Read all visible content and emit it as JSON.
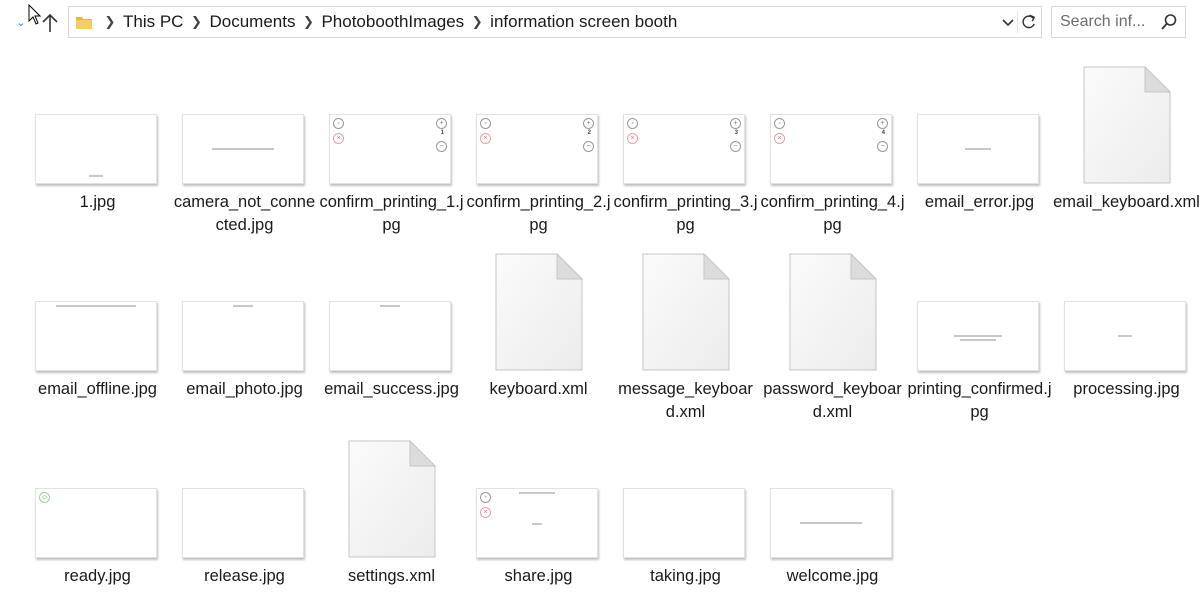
{
  "navbar": {
    "breadcrumb": [
      "This PC",
      "Documents",
      "PhotoboothImages",
      "information screen booth"
    ],
    "search_placeholder": "Search inf...",
    "icons": {
      "recent": "chevron-down-icon",
      "up": "up-arrow-icon",
      "folder": "folder-icon",
      "dropdown": "chevron-down-icon",
      "refresh": "refresh-icon",
      "search": "search-icon"
    }
  },
  "files": [
    {
      "name": "1.jpg",
      "type": "jpg"
    },
    {
      "name": "camera_not_connected.jpg",
      "type": "jpg"
    },
    {
      "name": "confirm_printing_1.jpg",
      "type": "jpg",
      "thumb_number": "1"
    },
    {
      "name": "confirm_printing_2.jpg",
      "type": "jpg",
      "thumb_number": "2"
    },
    {
      "name": "confirm_printing_3.jpg",
      "type": "jpg",
      "thumb_number": "3"
    },
    {
      "name": "confirm_printing_4.jpg",
      "type": "jpg",
      "thumb_number": "4"
    },
    {
      "name": "email_error.jpg",
      "type": "jpg"
    },
    {
      "name": "email_keyboard.xml",
      "type": "xml"
    },
    {
      "name": "email_offline.jpg",
      "type": "jpg"
    },
    {
      "name": "email_photo.jpg",
      "type": "jpg"
    },
    {
      "name": "email_success.jpg",
      "type": "jpg"
    },
    {
      "name": "keyboard.xml",
      "type": "xml"
    },
    {
      "name": "message_keyboard.xml",
      "type": "xml"
    },
    {
      "name": "password_keyboard.xml",
      "type": "xml"
    },
    {
      "name": "printing_confirmed.jpg",
      "type": "jpg"
    },
    {
      "name": "processing.jpg",
      "type": "jpg"
    },
    {
      "name": "ready.jpg",
      "type": "jpg"
    },
    {
      "name": "release.jpg",
      "type": "jpg"
    },
    {
      "name": "settings.xml",
      "type": "xml"
    },
    {
      "name": "share.jpg",
      "type": "jpg"
    },
    {
      "name": "taking.jpg",
      "type": "jpg"
    },
    {
      "name": "welcome.jpg",
      "type": "jpg"
    }
  ],
  "colors": {
    "accent": "#3b7fd4",
    "folder": "#e8b93c",
    "border": "#d9d9d9"
  }
}
